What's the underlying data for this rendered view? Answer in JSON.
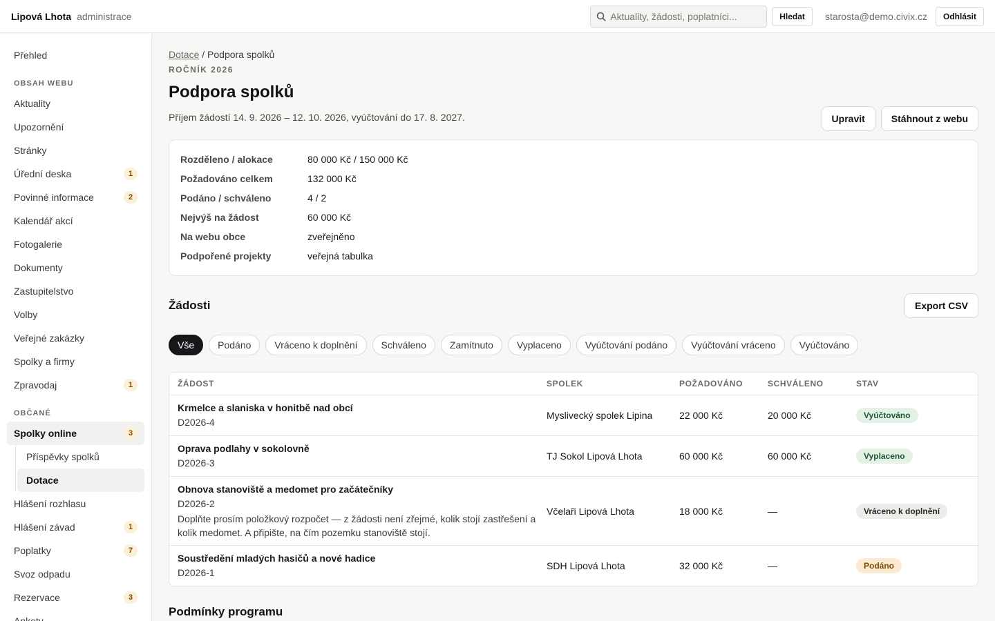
{
  "topbar": {
    "brand": "Lipová Lhota",
    "brand_sub": "administrace",
    "search_placeholder": "Aktuality, žádosti, poplatníci...",
    "search_button": "Hledat",
    "user_email": "starosta@demo.civix.cz",
    "logout_button": "Odhlásit"
  },
  "sidebar": {
    "overview": "Přehled",
    "section_web": "Obsah webu",
    "web_items": [
      {
        "label": "Aktuality",
        "badge": ""
      },
      {
        "label": "Upozornění",
        "badge": ""
      },
      {
        "label": "Stránky",
        "badge": ""
      },
      {
        "label": "Úřední deska",
        "badge": "1"
      },
      {
        "label": "Povinné informace",
        "badge": "2"
      },
      {
        "label": "Kalendář akcí",
        "badge": ""
      },
      {
        "label": "Fotogalerie",
        "badge": ""
      },
      {
        "label": "Dokumenty",
        "badge": ""
      },
      {
        "label": "Zastupitelstvo",
        "badge": ""
      },
      {
        "label": "Volby",
        "badge": ""
      },
      {
        "label": "Veřejné zakázky",
        "badge": ""
      },
      {
        "label": "Spolky a firmy",
        "badge": ""
      },
      {
        "label": "Zpravodaj",
        "badge": "1"
      }
    ],
    "section_citizens": "Občané",
    "spolky_online": {
      "label": "Spolky online",
      "badge": "3"
    },
    "sub_items": [
      {
        "label": "Příspěvky spolků"
      },
      {
        "label": "Dotace"
      }
    ],
    "citizen_items": [
      {
        "label": "Hlášení rozhlasu",
        "badge": ""
      },
      {
        "label": "Hlášení závad",
        "badge": "1"
      },
      {
        "label": "Poplatky",
        "badge": "7"
      },
      {
        "label": "Svoz odpadu",
        "badge": ""
      },
      {
        "label": "Rezervace",
        "badge": "3"
      },
      {
        "label": "Ankety",
        "badge": ""
      }
    ]
  },
  "page": {
    "breadcrumb_link": "Dotace",
    "breadcrumb_sep": "/",
    "breadcrumb_current": "Podpora spolků",
    "kicker": "Ročník 2026",
    "title": "Podpora spolků",
    "subtitle": "Příjem žádostí 14. 9. 2026 – 12. 10. 2026, vyúčtování do 17. 8. 2027.",
    "edit_button": "Upravit",
    "unpublish_button": "Stáhnout z webu"
  },
  "info": [
    {
      "k": "Rozděleno / alokace",
      "v": "80 000 Kč / 150 000 Kč"
    },
    {
      "k": "Požadováno celkem",
      "v": "132 000 Kč"
    },
    {
      "k": "Podáno / schváleno",
      "v": "4 / 2"
    },
    {
      "k": "Nejvýš na žádost",
      "v": "60 000 Kč"
    },
    {
      "k": "Na webu obce",
      "v": "zveřejněno"
    },
    {
      "k": "Podpořené projekty",
      "v": "veřejná tabulka"
    }
  ],
  "requests": {
    "title": "Žádosti",
    "export_button": "Export CSV",
    "filters": [
      "Vše",
      "Podáno",
      "Vráceno k doplnění",
      "Schváleno",
      "Zamítnuto",
      "Vyplaceno",
      "Vyúčtování podáno",
      "Vyúčtování vráceno",
      "Vyúčtováno"
    ],
    "active_filter": 0,
    "columns": [
      "Žádost",
      "Spolek",
      "Požadováno",
      "Schváleno",
      "Stav"
    ],
    "rows": [
      {
        "title": "Krmelce a slaniska v honitbě nad obcí",
        "id": "D2026-4",
        "note": "",
        "org": "Myslivecký spolek Lipina",
        "requested": "22 000 Kč",
        "approved": "20 000 Kč",
        "status": "Vyúčtováno",
        "status_bg": "#e3f1e6",
        "status_fg": "#1f5a2e"
      },
      {
        "title": "Oprava podlahy v sokolovně",
        "id": "D2026-3",
        "note": "",
        "org": "TJ Sokol Lipová Lhota",
        "requested": "60 000 Kč",
        "approved": "60 000 Kč",
        "status": "Vyplaceno",
        "status_bg": "#e3f1e6",
        "status_fg": "#1f5a2e"
      },
      {
        "title": "Obnova stanoviště a medomet pro začátečníky",
        "id": "D2026-2",
        "note": "Doplňte prosím položkový rozpočet — z žádosti není zřejmé, kolik stojí zastřešení a kolik medomet. A připište, na čím pozemku stanoviště stojí.",
        "org": "Včelaři Lipová Lhota",
        "requested": "18 000 Kč",
        "approved": "—",
        "status": "Vráceno k doplnění",
        "status_bg": "#ececea",
        "status_fg": "#2a2a27"
      },
      {
        "title": "Soustředění mladých hasičů a nové hadice",
        "id": "D2026-1",
        "note": "",
        "org": "SDH Lipová Lhota",
        "requested": "32 000 Kč",
        "approved": "—",
        "status": "Podáno",
        "status_bg": "#fcebd2",
        "status_fg": "#7a4b00"
      }
    ]
  },
  "conditions": {
    "title": "Podmínky programu"
  }
}
